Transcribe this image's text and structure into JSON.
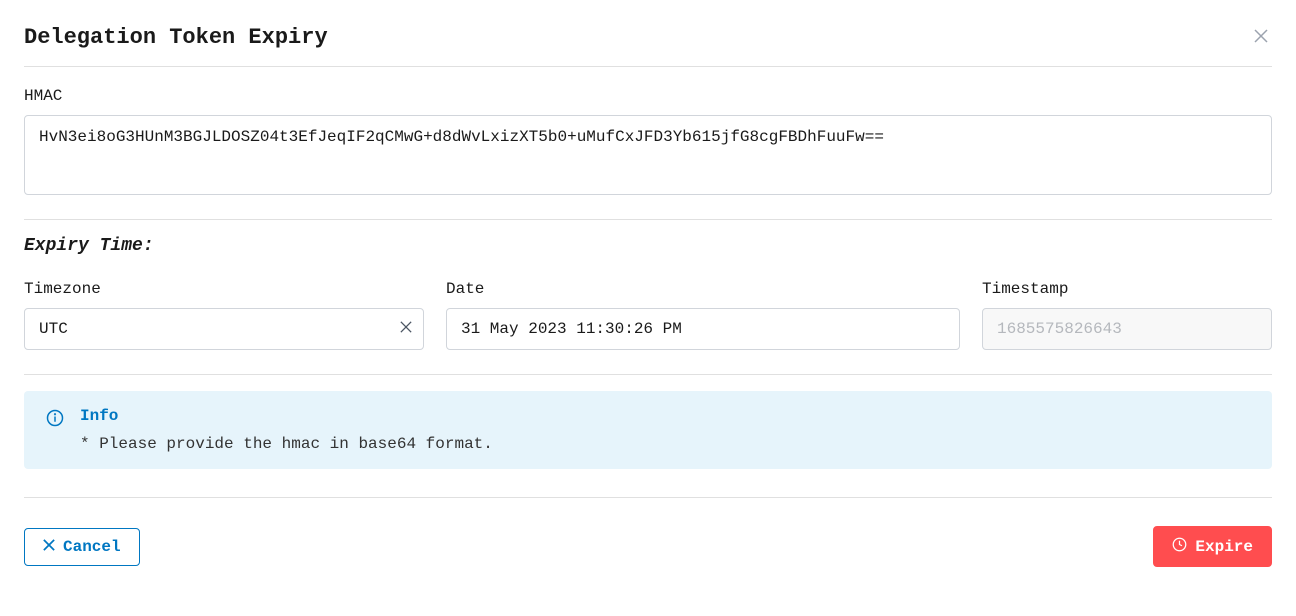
{
  "dialog": {
    "title": "Delegation Token Expiry"
  },
  "hmac": {
    "label": "HMAC",
    "value": "HvN3ei8oG3HUnM3BGJLDOSZ04t3EfJeqIF2qCMwG+d8dWvLxizXT5b0+uMufCxJFD3Yb615jfG8cgFBDhFuuFw=="
  },
  "expiry": {
    "heading": "Expiry Time:",
    "timezone": {
      "label": "Timezone",
      "value": "UTC"
    },
    "date": {
      "label": "Date",
      "value": "31 May 2023 11:30:26 PM"
    },
    "timestamp": {
      "label": "Timestamp",
      "value": "1685575826643"
    }
  },
  "info": {
    "title": "Info",
    "text": "* Please provide the hmac in base64 format."
  },
  "footer": {
    "cancel": "Cancel",
    "expire": "Expire"
  }
}
